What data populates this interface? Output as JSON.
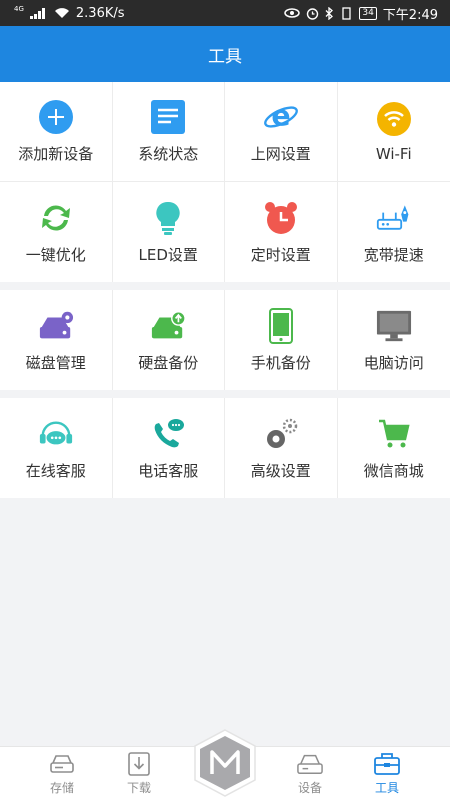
{
  "status_bar": {
    "network": "4G",
    "speed": "2.36K/s",
    "battery": "34",
    "time": "下午2:49"
  },
  "header": {
    "title": "工具"
  },
  "sections": [
    {
      "items": [
        {
          "label": "添加新设备",
          "icon": "add-circle-icon",
          "color": "#2f9cf0"
        },
        {
          "label": "系统状态",
          "icon": "document-icon",
          "color": "#2f9cf0"
        },
        {
          "label": "上网设置",
          "icon": "internet-explorer-icon",
          "color": "#2f9cf0"
        },
        {
          "label": "Wi-Fi",
          "icon": "wifi-icon",
          "color": "#f4b400"
        },
        {
          "label": "一键优化",
          "icon": "refresh-icon",
          "color": "#4cb84c"
        },
        {
          "label": "LED设置",
          "icon": "lightbulb-icon",
          "color": "#3cc6c0"
        },
        {
          "label": "定时设置",
          "icon": "alarm-clock-icon",
          "color": "#f0584f"
        },
        {
          "label": "宽带提速",
          "icon": "router-rocket-icon",
          "color": "#2f9cf0"
        }
      ]
    },
    {
      "items": [
        {
          "label": "磁盘管理",
          "icon": "disk-gear-icon",
          "color": "#7a63c8"
        },
        {
          "label": "硬盘备份",
          "icon": "disk-upload-icon",
          "color": "#4cb84c"
        },
        {
          "label": "手机备份",
          "icon": "phone-icon",
          "color": "#4cb84c"
        },
        {
          "label": "电脑访问",
          "icon": "monitor-icon",
          "color": "#6b6b6b"
        }
      ]
    },
    {
      "items": [
        {
          "label": "在线客服",
          "icon": "headset-chat-icon",
          "color": "#3cc6c0"
        },
        {
          "label": "电话客服",
          "icon": "phone-call-icon",
          "color": "#1aa89c"
        },
        {
          "label": "高级设置",
          "icon": "gears-icon",
          "color": "#666666"
        },
        {
          "label": "微信商城",
          "icon": "cart-icon",
          "color": "#4cb84c"
        }
      ]
    }
  ],
  "bottom_nav": {
    "items": [
      {
        "label": "存储",
        "icon": "storage-icon"
      },
      {
        "label": "下载",
        "icon": "download-icon"
      },
      {
        "label": "设备",
        "icon": "router-icon"
      },
      {
        "label": "工具",
        "icon": "toolbox-icon",
        "active": true
      }
    ],
    "center": {
      "label": "M",
      "icon": "hexagon-m-icon"
    }
  },
  "colors": {
    "accent": "#1e86e0",
    "status_bar": "#2b2b2b",
    "background": "#f2f3f5"
  }
}
